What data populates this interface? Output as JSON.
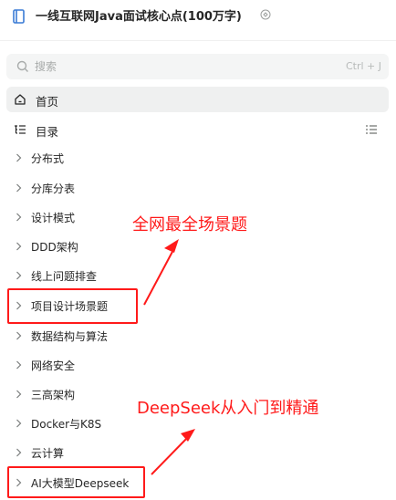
{
  "header": {
    "title": "一线互联网Java面试核心点(100万字)",
    "book_icon": "book-icon",
    "info_icon": "info-icon"
  },
  "search": {
    "placeholder": "搜索",
    "shortcut": "Ctrl + J"
  },
  "nav": {
    "home_label": "首页",
    "catalog_label": "目录"
  },
  "tree": [
    {
      "label": "分布式"
    },
    {
      "label": "分库分表"
    },
    {
      "label": "设计模式"
    },
    {
      "label": "DDD架构"
    },
    {
      "label": "线上问题排查"
    },
    {
      "label": "项目设计场景题"
    },
    {
      "label": "数据结构与算法"
    },
    {
      "label": "网络安全"
    },
    {
      "label": "三高架构"
    },
    {
      "label": "Docker与K8S"
    },
    {
      "label": "云计算"
    },
    {
      "label": "AI大模型Deepseek"
    }
  ],
  "annotations": {
    "first": "全网最全场景题",
    "second": "DeepSeek从入门到精通",
    "color": "#ff1a1a"
  }
}
